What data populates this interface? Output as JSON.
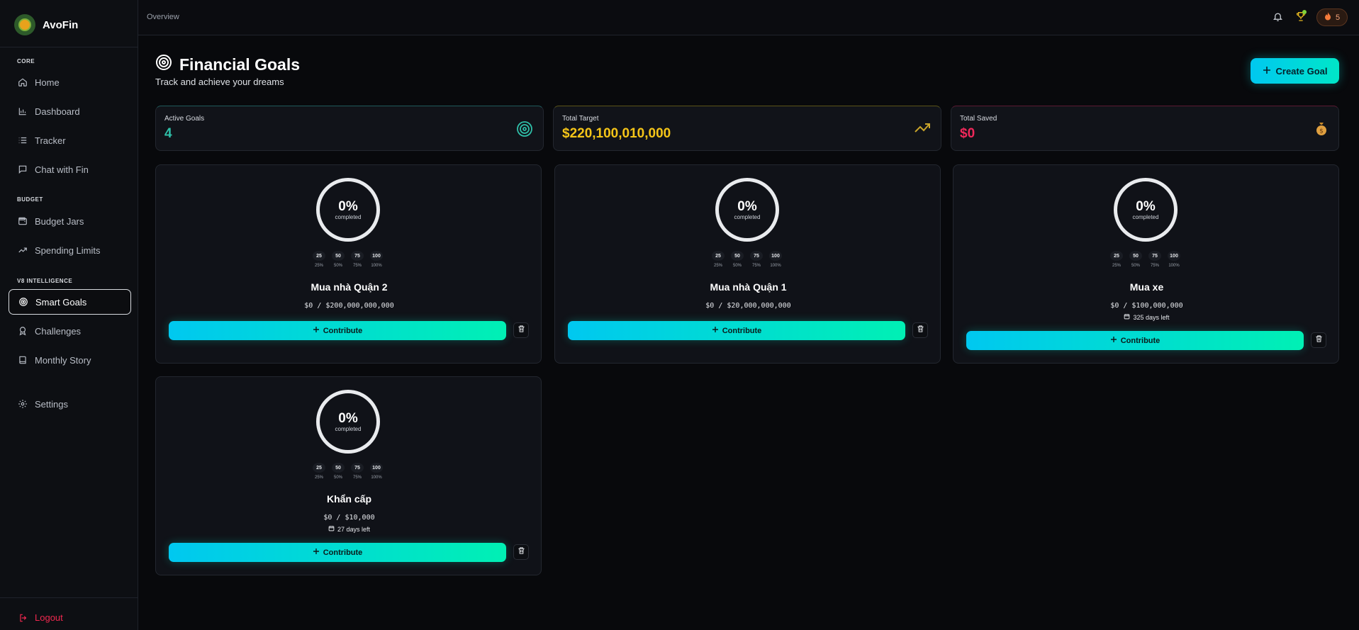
{
  "app": {
    "name": "AvoFin"
  },
  "sidebar": {
    "sections": [
      {
        "label": "CORE",
        "items": [
          {
            "label": "Home",
            "icon": "home-icon"
          },
          {
            "label": "Dashboard",
            "icon": "bar-chart-icon"
          },
          {
            "label": "Tracker",
            "icon": "list-icon"
          },
          {
            "label": "Chat with Fin",
            "icon": "chat-icon"
          }
        ]
      },
      {
        "label": "BUDGET",
        "items": [
          {
            "label": "Budget Jars",
            "icon": "wallet-icon"
          },
          {
            "label": "Spending Limits",
            "icon": "trend-icon"
          }
        ]
      },
      {
        "label": "V8 INTELLIGENCE",
        "items": [
          {
            "label": "Smart Goals",
            "icon": "target-icon",
            "active": true
          },
          {
            "label": "Challenges",
            "icon": "medal-icon"
          },
          {
            "label": "Monthly Story",
            "icon": "book-icon"
          }
        ]
      }
    ],
    "settings_label": "Settings",
    "logout_label": "Logout"
  },
  "topbar": {
    "breadcrumb": "Overview",
    "streak_count": "5"
  },
  "page": {
    "title": "Financial Goals",
    "subtitle": "Track and achieve your dreams",
    "create_label": "Create Goal"
  },
  "stats": [
    {
      "label": "Active Goals",
      "value": "4",
      "color": "#2fbfa8",
      "icon": "target-icon"
    },
    {
      "label": "Total Target",
      "value": "$220,100,010,000",
      "color": "#f5c518",
      "icon": "trending-up-icon"
    },
    {
      "label": "Total Saved",
      "value": "$0",
      "color": "#f0285a",
      "icon": "money-bag-icon"
    }
  ],
  "goals": [
    {
      "name": "Mua nhà Quận 2",
      "amount": "$0 / $200,000,000,000",
      "percent": "0%",
      "completed": "completed",
      "days_left": "",
      "progress": 0
    },
    {
      "name": "Mua nhà Quận 1",
      "amount": "$0 / $20,000,000,000",
      "percent": "0%",
      "completed": "completed",
      "days_left": "",
      "progress": 0
    },
    {
      "name": "Mua xe",
      "amount": "$0 / $100,000,000",
      "percent": "0%",
      "completed": "completed",
      "days_left": "325 days left",
      "progress": 0
    },
    {
      "name": "Khẩn cấp",
      "amount": "$0 / $10,000",
      "percent": "0%",
      "completed": "completed",
      "days_left": "27 days left",
      "progress": 0
    }
  ],
  "milestones": [
    {
      "value": "25",
      "label": "25%"
    },
    {
      "value": "50",
      "label": "50%"
    },
    {
      "value": "75",
      "label": "75%"
    },
    {
      "value": "100",
      "label": "100%"
    }
  ],
  "contribute_label": "Contribute"
}
